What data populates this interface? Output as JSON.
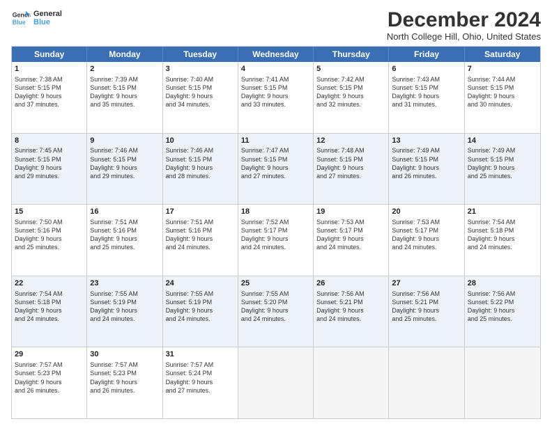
{
  "header": {
    "logo_line1": "General",
    "logo_line2": "Blue",
    "title": "December 2024",
    "subtitle": "North College Hill, Ohio, United States"
  },
  "days_of_week": [
    "Sunday",
    "Monday",
    "Tuesday",
    "Wednesday",
    "Thursday",
    "Friday",
    "Saturday"
  ],
  "weeks": [
    [
      {
        "day": "1",
        "text": "Sunrise: 7:38 AM\nSunset: 5:15 PM\nDaylight: 9 hours\nand 37 minutes."
      },
      {
        "day": "2",
        "text": "Sunrise: 7:39 AM\nSunset: 5:15 PM\nDaylight: 9 hours\nand 35 minutes."
      },
      {
        "day": "3",
        "text": "Sunrise: 7:40 AM\nSunset: 5:15 PM\nDaylight: 9 hours\nand 34 minutes."
      },
      {
        "day": "4",
        "text": "Sunrise: 7:41 AM\nSunset: 5:15 PM\nDaylight: 9 hours\nand 33 minutes."
      },
      {
        "day": "5",
        "text": "Sunrise: 7:42 AM\nSunset: 5:15 PM\nDaylight: 9 hours\nand 32 minutes."
      },
      {
        "day": "6",
        "text": "Sunrise: 7:43 AM\nSunset: 5:15 PM\nDaylight: 9 hours\nand 31 minutes."
      },
      {
        "day": "7",
        "text": "Sunrise: 7:44 AM\nSunset: 5:15 PM\nDaylight: 9 hours\nand 30 minutes."
      }
    ],
    [
      {
        "day": "8",
        "text": "Sunrise: 7:45 AM\nSunset: 5:15 PM\nDaylight: 9 hours\nand 29 minutes."
      },
      {
        "day": "9",
        "text": "Sunrise: 7:46 AM\nSunset: 5:15 PM\nDaylight: 9 hours\nand 29 minutes."
      },
      {
        "day": "10",
        "text": "Sunrise: 7:46 AM\nSunset: 5:15 PM\nDaylight: 9 hours\nand 28 minutes."
      },
      {
        "day": "11",
        "text": "Sunrise: 7:47 AM\nSunset: 5:15 PM\nDaylight: 9 hours\nand 27 minutes."
      },
      {
        "day": "12",
        "text": "Sunrise: 7:48 AM\nSunset: 5:15 PM\nDaylight: 9 hours\nand 27 minutes."
      },
      {
        "day": "13",
        "text": "Sunrise: 7:49 AM\nSunset: 5:15 PM\nDaylight: 9 hours\nand 26 minutes."
      },
      {
        "day": "14",
        "text": "Sunrise: 7:49 AM\nSunset: 5:15 PM\nDaylight: 9 hours\nand 25 minutes."
      }
    ],
    [
      {
        "day": "15",
        "text": "Sunrise: 7:50 AM\nSunset: 5:16 PM\nDaylight: 9 hours\nand 25 minutes."
      },
      {
        "day": "16",
        "text": "Sunrise: 7:51 AM\nSunset: 5:16 PM\nDaylight: 9 hours\nand 25 minutes."
      },
      {
        "day": "17",
        "text": "Sunrise: 7:51 AM\nSunset: 5:16 PM\nDaylight: 9 hours\nand 24 minutes."
      },
      {
        "day": "18",
        "text": "Sunrise: 7:52 AM\nSunset: 5:17 PM\nDaylight: 9 hours\nand 24 minutes."
      },
      {
        "day": "19",
        "text": "Sunrise: 7:53 AM\nSunset: 5:17 PM\nDaylight: 9 hours\nand 24 minutes."
      },
      {
        "day": "20",
        "text": "Sunrise: 7:53 AM\nSunset: 5:17 PM\nDaylight: 9 hours\nand 24 minutes."
      },
      {
        "day": "21",
        "text": "Sunrise: 7:54 AM\nSunset: 5:18 PM\nDaylight: 9 hours\nand 24 minutes."
      }
    ],
    [
      {
        "day": "22",
        "text": "Sunrise: 7:54 AM\nSunset: 5:18 PM\nDaylight: 9 hours\nand 24 minutes."
      },
      {
        "day": "23",
        "text": "Sunrise: 7:55 AM\nSunset: 5:19 PM\nDaylight: 9 hours\nand 24 minutes."
      },
      {
        "day": "24",
        "text": "Sunrise: 7:55 AM\nSunset: 5:19 PM\nDaylight: 9 hours\nand 24 minutes."
      },
      {
        "day": "25",
        "text": "Sunrise: 7:55 AM\nSunset: 5:20 PM\nDaylight: 9 hours\nand 24 minutes."
      },
      {
        "day": "26",
        "text": "Sunrise: 7:56 AM\nSunset: 5:21 PM\nDaylight: 9 hours\nand 24 minutes."
      },
      {
        "day": "27",
        "text": "Sunrise: 7:56 AM\nSunset: 5:21 PM\nDaylight: 9 hours\nand 25 minutes."
      },
      {
        "day": "28",
        "text": "Sunrise: 7:56 AM\nSunset: 5:22 PM\nDaylight: 9 hours\nand 25 minutes."
      }
    ],
    [
      {
        "day": "29",
        "text": "Sunrise: 7:57 AM\nSunset: 5:23 PM\nDaylight: 9 hours\nand 26 minutes."
      },
      {
        "day": "30",
        "text": "Sunrise: 7:57 AM\nSunset: 5:23 PM\nDaylight: 9 hours\nand 26 minutes."
      },
      {
        "day": "31",
        "text": "Sunrise: 7:57 AM\nSunset: 5:24 PM\nDaylight: 9 hours\nand 27 minutes."
      },
      {
        "day": "",
        "text": ""
      },
      {
        "day": "",
        "text": ""
      },
      {
        "day": "",
        "text": ""
      },
      {
        "day": "",
        "text": ""
      }
    ]
  ]
}
